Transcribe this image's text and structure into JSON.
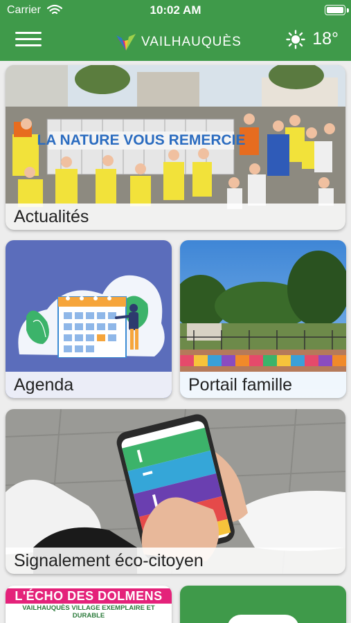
{
  "status_bar": {
    "carrier": "Carrier",
    "time": "10:02 AM"
  },
  "header": {
    "app_name": "VAILHAUQUÈS",
    "weather": {
      "icon": "sun-icon",
      "temperature": "18°"
    },
    "colors": {
      "primary": "#3f9a4a"
    }
  },
  "tiles": [
    {
      "label": "Actualités",
      "banner_text": "LA NATURE VOUS REMERCIE"
    },
    {
      "label": "Agenda"
    },
    {
      "label": "Portail famille"
    },
    {
      "label": "Signalement éco-citoyen"
    },
    {
      "title": "L'ÉCHO DES DOLMENS",
      "subtitle": "VAILHAUQUÈS VILLAGE EXEMPLAIRE ET DURABLE"
    },
    {
      "label": ""
    }
  ]
}
